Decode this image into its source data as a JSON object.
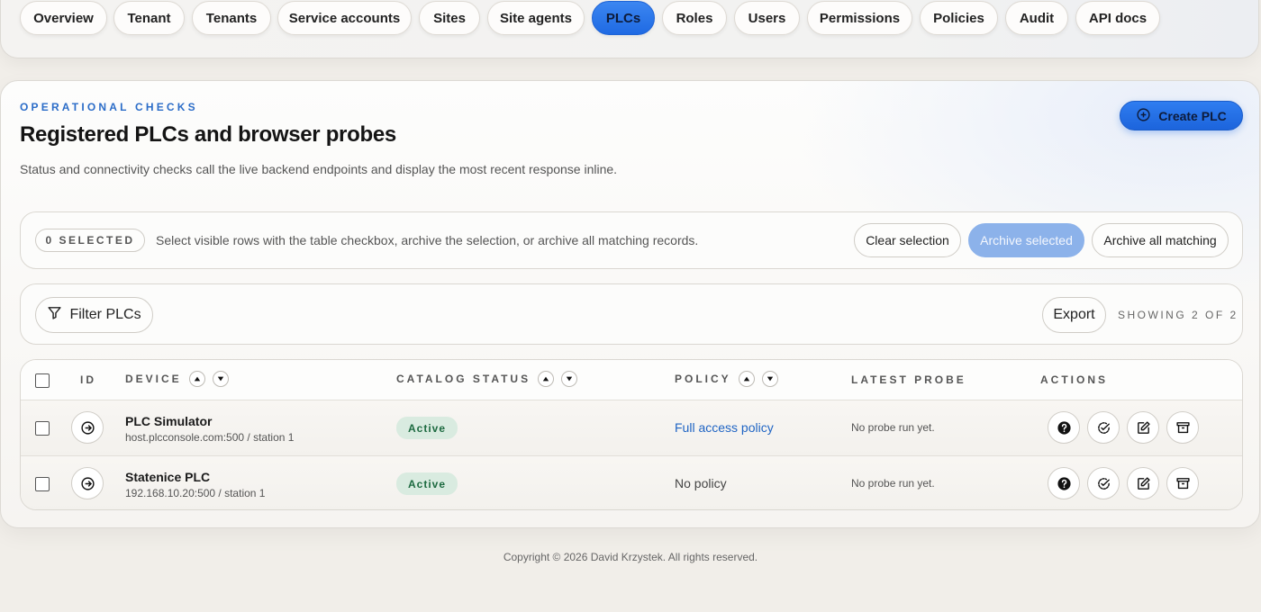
{
  "nav": {
    "tabs": [
      {
        "label": "Overview"
      },
      {
        "label": "Tenant"
      },
      {
        "label": "Tenants"
      },
      {
        "label": "Service accounts"
      },
      {
        "label": "Sites"
      },
      {
        "label": "Site agents"
      },
      {
        "label": "PLCs",
        "active": true
      },
      {
        "label": "Roles"
      },
      {
        "label": "Users"
      },
      {
        "label": "Permissions"
      },
      {
        "label": "Policies"
      },
      {
        "label": "Audit"
      },
      {
        "label": "API docs"
      }
    ]
  },
  "header": {
    "eyebrow": "OPERATIONAL CHECKS",
    "title": "Registered PLCs and browser probes",
    "description": "Status and connectivity checks call the live backend endpoints and display the most recent response inline.",
    "create_label": "Create PLC",
    "create_icon": "plus-circle-icon"
  },
  "selection": {
    "badge": "0 SELECTED",
    "help": "Select visible rows with the table checkbox, archive the selection, or archive all matching records.",
    "clear_label": "Clear selection",
    "archive_selected_label": "Archive selected",
    "archive_all_label": "Archive all matching"
  },
  "toolbar": {
    "filter_label": "Filter PLCs",
    "export_label": "Export",
    "showing": "SHOWING 2 OF 2"
  },
  "table": {
    "columns": {
      "id": "ID",
      "device": "DEVICE",
      "catalog_status": "CATALOG STATUS",
      "policy": "POLICY",
      "latest_probe": "LATEST PROBE",
      "actions": "ACTIONS"
    },
    "rows": [
      {
        "name": "PLC Simulator",
        "address": "host.plcconsole.com:500 / station 1",
        "status": "Active",
        "policy": "Full access policy",
        "policy_is_link": true,
        "probe": "No probe run yet."
      },
      {
        "name": "Statenice PLC",
        "address": "192.168.10.20:500 / station 1",
        "status": "Active",
        "policy": "No policy",
        "policy_is_link": false,
        "probe": "No probe run yet."
      }
    ],
    "action_icons": [
      "help-icon",
      "check-circle-icon",
      "edit-icon",
      "archive-icon"
    ]
  },
  "footer": {
    "copyright": "Copyright © 2026 David Krzystek. All rights reserved."
  },
  "colors": {
    "accent": "#1f6ae3",
    "accent_soft": "#8cb2ea",
    "eyebrow": "#2b6cc8",
    "status_bg": "#d9ebe0",
    "status_text": "#1d6a40",
    "link": "#2065c4"
  }
}
